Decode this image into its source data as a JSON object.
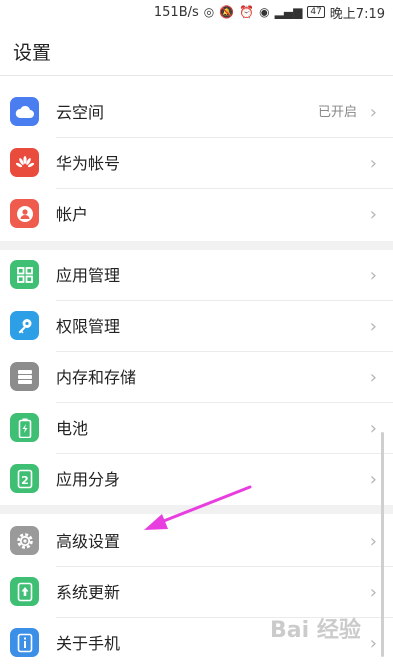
{
  "status_bar": {
    "speed": "151B/s",
    "battery": "47",
    "time": "晚上7:19"
  },
  "header": {
    "title": "设置"
  },
  "groups": [
    {
      "items": [
        {
          "label": "云空间",
          "value": "已开启",
          "icon": "cloud-icon",
          "color": "#4a7ef0"
        },
        {
          "label": "华为帐号",
          "value": "",
          "icon": "huawei-logo-icon",
          "color": "#e94b3c"
        },
        {
          "label": "帐户",
          "value": "",
          "icon": "user-icon",
          "color": "#ef5b4c"
        }
      ]
    },
    {
      "items": [
        {
          "label": "应用管理",
          "value": "",
          "icon": "grid-apps-icon",
          "color": "#3fbf74"
        },
        {
          "label": "权限管理",
          "value": "",
          "icon": "key-icon",
          "color": "#2d9fe6"
        },
        {
          "label": "内存和存储",
          "value": "",
          "icon": "storage-icon",
          "color": "#8c8c8c"
        },
        {
          "label": "电池",
          "value": "",
          "icon": "battery-icon",
          "color": "#3fbf74"
        },
        {
          "label": "应用分身",
          "value": "",
          "icon": "app-twin-icon",
          "color": "#3fbf74"
        }
      ]
    },
    {
      "items": [
        {
          "label": "高级设置",
          "value": "",
          "icon": "gear-icon",
          "color": "#9a9a9a"
        },
        {
          "label": "系统更新",
          "value": "",
          "icon": "system-update-icon",
          "color": "#3fbf74"
        },
        {
          "label": "关于手机",
          "value": "",
          "icon": "phone-info-icon",
          "color": "#3b8fe6"
        }
      ]
    }
  ],
  "annotation_color": "#e83ee0",
  "watermark": "Bai 经验"
}
